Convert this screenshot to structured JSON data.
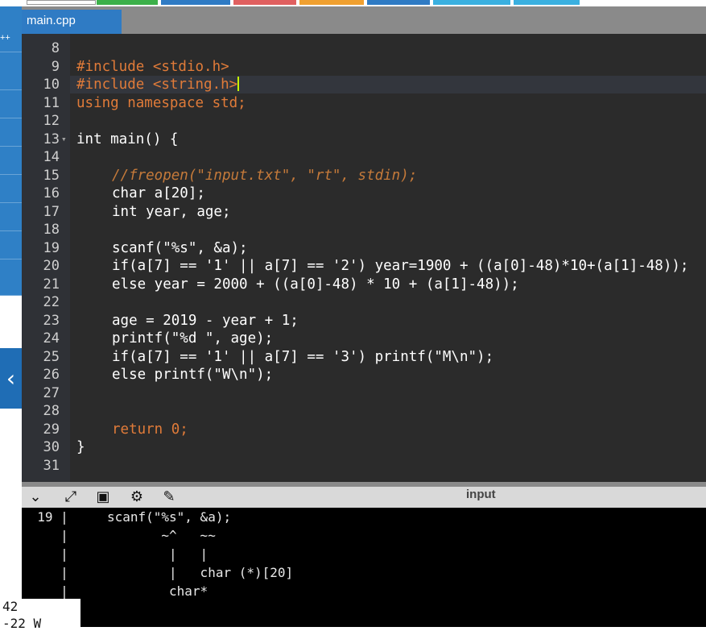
{
  "tabs": {
    "active_file": "main.cpp"
  },
  "sidebar": {
    "top_label": "++",
    "collapse_icon": "‹"
  },
  "editor": {
    "lines": [
      {
        "n": "8",
        "fold": false
      },
      {
        "n": "9"
      },
      {
        "n": "10"
      },
      {
        "n": "11"
      },
      {
        "n": "12"
      },
      {
        "n": "13",
        "fold": true
      },
      {
        "n": "14"
      },
      {
        "n": "15"
      },
      {
        "n": "16"
      },
      {
        "n": "17"
      },
      {
        "n": "18"
      },
      {
        "n": "19"
      },
      {
        "n": "20"
      },
      {
        "n": "21"
      },
      {
        "n": "22"
      },
      {
        "n": "23"
      },
      {
        "n": "24"
      },
      {
        "n": "25"
      },
      {
        "n": "26"
      },
      {
        "n": "27"
      },
      {
        "n": "28"
      },
      {
        "n": "29"
      },
      {
        "n": "30"
      },
      {
        "n": "31"
      }
    ],
    "code": {
      "l9": "#include <stdio.h>",
      "l10": "#include <string.h>",
      "l11": "using namespace std;",
      "l13": "int main() {",
      "l15": "//freopen(\"input.txt\", \"rt\", stdin);",
      "l16": "char a[20];",
      "l17": "int year, age;",
      "l19": "scanf(\"%s\", &a);",
      "l20": "if(a[7] == '1' || a[7] == '2') year=1900 + ((a[0]-48)*10+(a[1]-48));",
      "l21": "else year = 2000 + ((a[0]-48) * 10 + (a[1]-48));",
      "l23": "age = 2019 - year + 1;",
      "l24": "printf(\"%d \", age);",
      "l25": "if(a[7] == '1' || a[7] == '3') printf(\"M\\n\");",
      "l26": "else printf(\"W\\n\");",
      "l29": "return 0;",
      "l30": "}"
    }
  },
  "panel": {
    "title": "input",
    "icons": [
      "chevron-down-icon",
      "expand-icon",
      "panel-icon",
      "gear-icon",
      "clean-icon"
    ]
  },
  "terminal": {
    "lines": [
      "  19 |     scanf(\"%s\", &a);",
      "     |            ~^   ~~",
      "     |             |   |",
      "     |             |   char (*)[20]",
      "     |             char*"
    ]
  },
  "output": {
    "lines": [
      "42",
      "-22 W"
    ]
  },
  "colors": {
    "accent": "#2f7bc4",
    "editor_bg": "#2b2b2b",
    "terminal_bg": "#000000"
  }
}
